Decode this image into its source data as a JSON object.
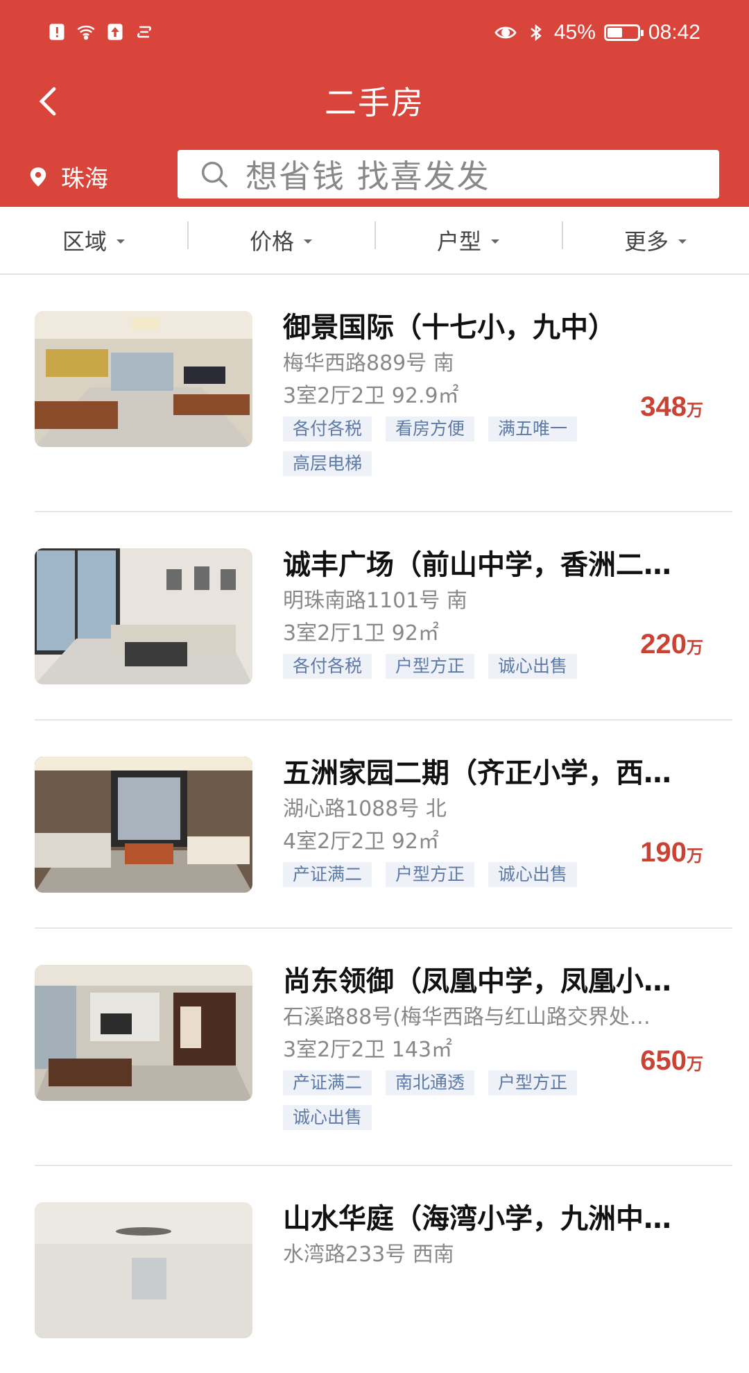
{
  "status_bar": {
    "battery": "45%",
    "battery_level": 0.45,
    "time": "08:42",
    "left_icons": [
      "alert-icon",
      "wifi-icon",
      "upload-icon",
      "sync-icon"
    ],
    "right_icons": [
      "eye-icon",
      "bluetooth-icon"
    ]
  },
  "header": {
    "title": "二手房",
    "city": "珠海",
    "search_placeholder": "想省钱 找喜发发",
    "accent_color": "#d9453a"
  },
  "filters": [
    {
      "label": "区域"
    },
    {
      "label": "价格"
    },
    {
      "label": "户型"
    },
    {
      "label": "更多"
    }
  ],
  "listings": [
    {
      "title": "御景国际（十七小，九中）",
      "address": "梅华西路889号 南",
      "layout": "3室2厅2卫 92.9㎡",
      "price": "348",
      "unit": "万",
      "tags": [
        "各付各税",
        "看房方便",
        "满五唯一",
        "高层电梯"
      ]
    },
    {
      "title": "诚丰广场（前山中学，香洲二…",
      "address": "明珠南路1101号 南",
      "layout": "3室2厅1卫 92㎡",
      "price": "220",
      "unit": "万",
      "tags": [
        "各付各税",
        "户型方正",
        "诚心出售"
      ]
    },
    {
      "title": "五洲家园二期（齐正小学，西…",
      "address": "湖心路1088号 北",
      "layout": "4室2厅2卫 92㎡",
      "price": "190",
      "unit": "万",
      "tags": [
        "产证满二",
        "户型方正",
        "诚心出售"
      ]
    },
    {
      "title": "尚东领御（凤凰中学，凤凰小…",
      "address": "石溪路88号(梅华西路与红山路交界处…",
      "layout": "3室2厅2卫 143㎡",
      "price": "650",
      "unit": "万",
      "tags": [
        "产证满二",
        "南北通透",
        "户型方正",
        "诚心出售"
      ]
    },
    {
      "title": "山水华庭（海湾小学，九洲中…",
      "address": "水湾路233号 西南",
      "layout": "",
      "price": "",
      "unit": "",
      "tags": []
    }
  ]
}
